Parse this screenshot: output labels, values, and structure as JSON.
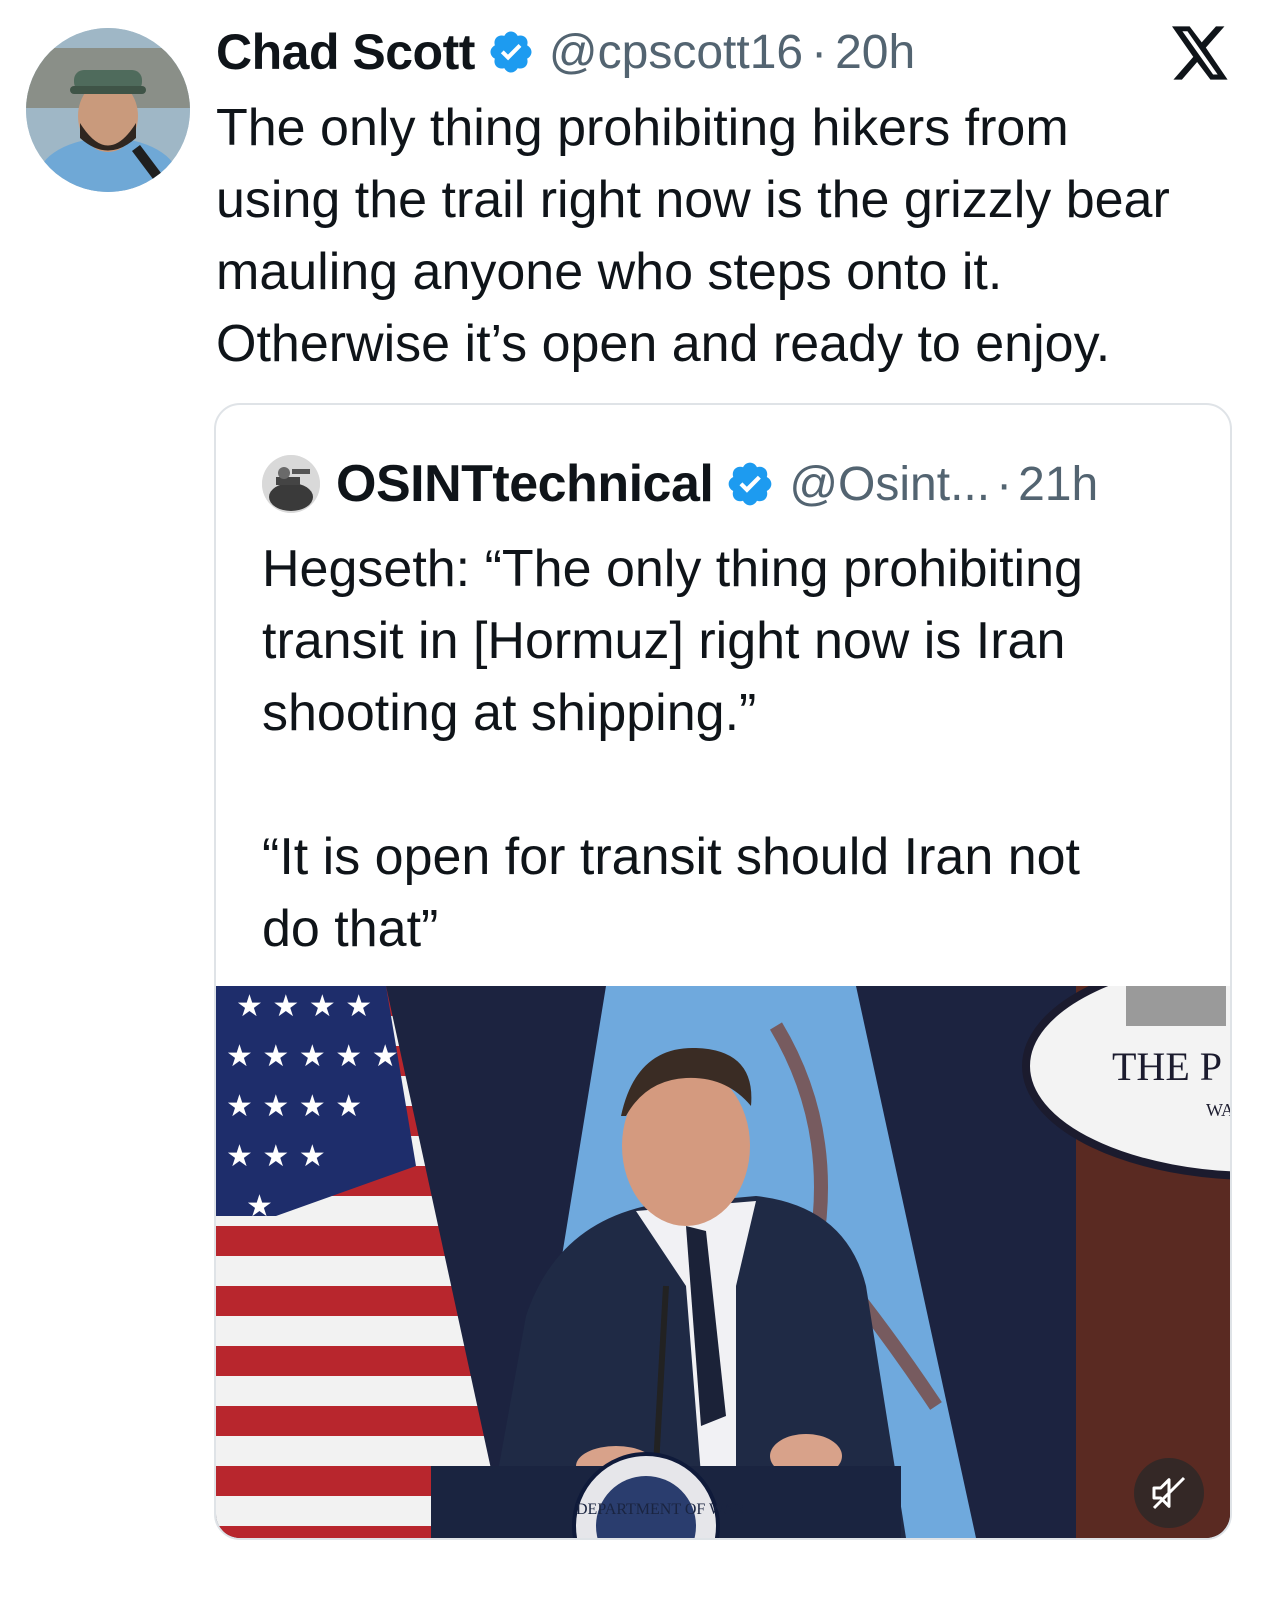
{
  "tweet": {
    "author_name": "Chad Scott",
    "handle": "@cpscott16",
    "separator": "·",
    "time": "20h",
    "text_lines": [
      "The only thing prohibiting hikers from",
      "using the trail right now is the grizzly bear",
      "mauling anyone who steps onto it.",
      "Otherwise it’s open and ready to enjoy."
    ]
  },
  "quote": {
    "author_name": "OSINTtechnical",
    "handle": "@Osint...",
    "separator": "·",
    "time": "21h",
    "paragraph1_lines": [
      "Hegseth: “The only thing prohibiting",
      "transit in [Hormuz] right now is Iran",
      "shooting at shipping.”"
    ],
    "paragraph2_lines": [
      "“It is open for transit should Iran not",
      "do that”"
    ],
    "media": {
      "seal_text": "THE P",
      "seal_subtext": "WA",
      "podium_seal_text": "DEPARTMENT OF WAR"
    }
  },
  "colors": {
    "verified_blue": "#1d9bf0",
    "text_primary": "#0f1419",
    "text_secondary": "#536471",
    "border": "#dfe3e7"
  },
  "icons": {
    "verified": "verified-badge-icon",
    "platform": "x-logo-icon",
    "mute": "muted-speaker-icon"
  }
}
